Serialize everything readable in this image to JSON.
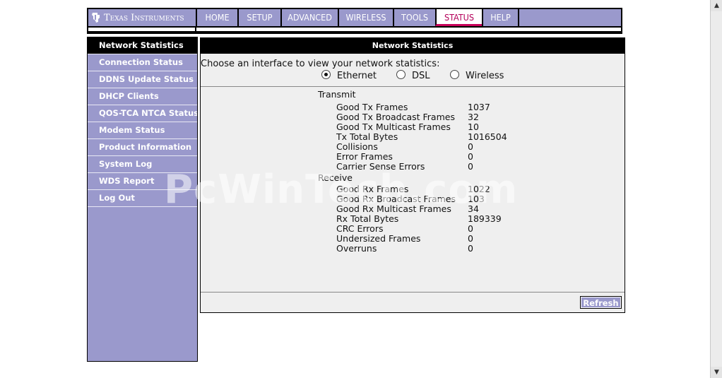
{
  "brand": {
    "name": "Texas Instruments",
    "icon": "ti-logo-icon"
  },
  "nav": {
    "tabs": [
      {
        "label": "HOME",
        "active": false
      },
      {
        "label": "SETUP",
        "active": false
      },
      {
        "label": "ADVANCED",
        "active": false
      },
      {
        "label": "WIRELESS",
        "active": false
      },
      {
        "label": "TOOLS",
        "active": false
      },
      {
        "label": "STATUS",
        "active": true
      },
      {
        "label": "HELP",
        "active": false
      }
    ]
  },
  "sidebar": {
    "items": [
      {
        "label": "Network Statistics",
        "active": true
      },
      {
        "label": "Connection Status"
      },
      {
        "label": "DDNS Update Status"
      },
      {
        "label": "DHCP Clients"
      },
      {
        "label": "QOS-TCA NTCA Status"
      },
      {
        "label": "Modem Status"
      },
      {
        "label": "Product Information"
      },
      {
        "label": "System Log"
      },
      {
        "label": "WDS Report"
      },
      {
        "label": "Log Out"
      }
    ]
  },
  "panel": {
    "title": "Network Statistics",
    "prompt": "Choose an interface to view your network statistics:",
    "interfaces": [
      {
        "label": "Ethernet",
        "selected": true
      },
      {
        "label": "DSL",
        "selected": false
      },
      {
        "label": "Wireless",
        "selected": false
      }
    ],
    "transmit": {
      "heading": "Transmit",
      "stats": [
        {
          "label": "Good Tx Frames",
          "value": "1037"
        },
        {
          "label": "Good Tx Broadcast Frames",
          "value": "32"
        },
        {
          "label": "Good Tx Multicast Frames",
          "value": "10"
        },
        {
          "label": "Tx Total Bytes",
          "value": "1016504"
        },
        {
          "label": "Collisions",
          "value": "0"
        },
        {
          "label": "Error Frames",
          "value": "0"
        },
        {
          "label": "Carrier Sense Errors",
          "value": "0"
        }
      ]
    },
    "receive": {
      "heading": "Receive",
      "stats": [
        {
          "label": "Good Rx Frames",
          "value": "1022"
        },
        {
          "label": "Good Rx Broadcast Frames",
          "value": "103"
        },
        {
          "label": "Good Rx Multicast Frames",
          "value": "34"
        },
        {
          "label": "Rx Total Bytes",
          "value": "189339"
        },
        {
          "label": "CRC Errors",
          "value": "0"
        },
        {
          "label": "Undersized Frames",
          "value": "0"
        },
        {
          "label": "Overruns",
          "value": "0"
        }
      ]
    },
    "refresh_label": "Refresh"
  },
  "watermark": "PcWinTech.com",
  "colors": {
    "lavender": "#9a99cc",
    "active_tab": "#c8005a",
    "panel_bg": "#efefef"
  }
}
